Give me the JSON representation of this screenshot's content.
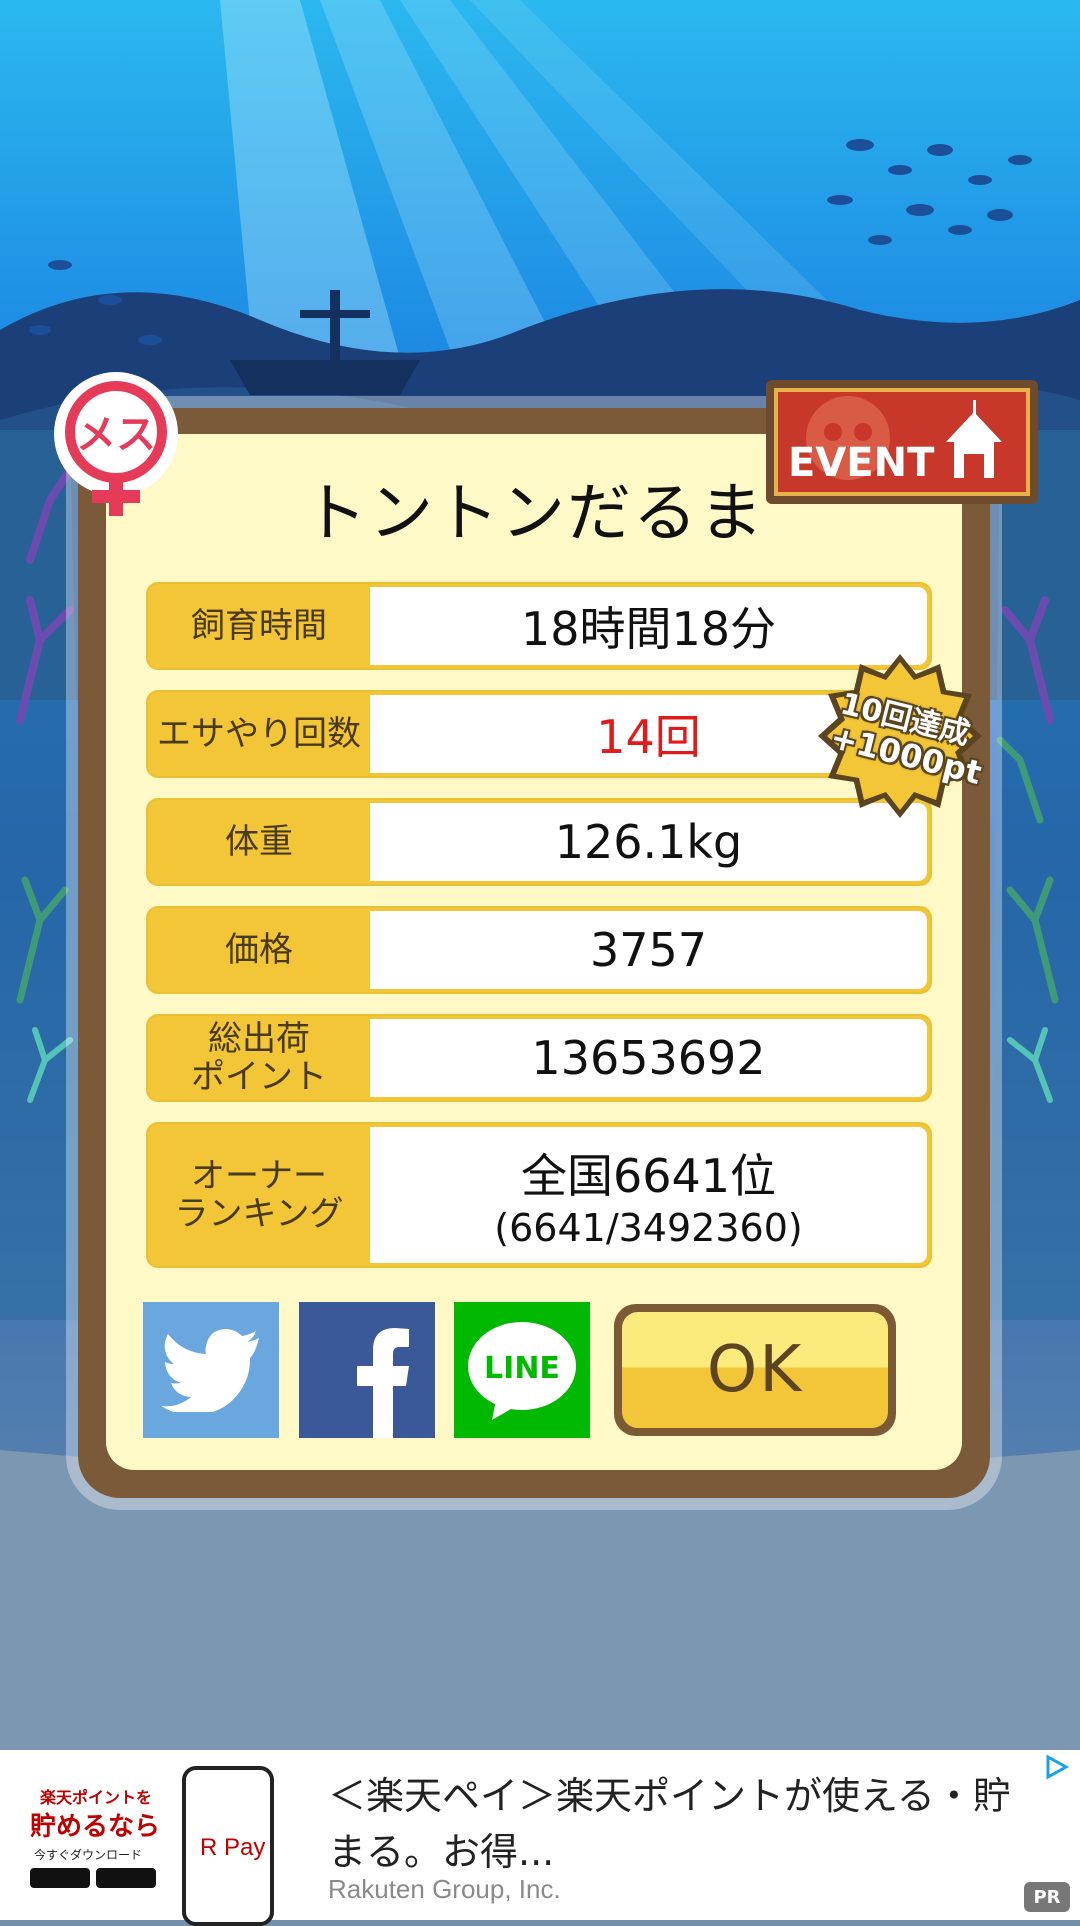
{
  "fish": {
    "gender_label": "メス",
    "name": "トントンだるま"
  },
  "event_badge": {
    "label": "EVENT"
  },
  "achievement_badge": {
    "line1": "10回達成",
    "line2": "+1000pt"
  },
  "stats": [
    {
      "label": "飼育時間",
      "value": "18時間18分"
    },
    {
      "label": "エサやり回数",
      "value": "14回",
      "highlight_color": "#e11a1a"
    },
    {
      "label": "体重",
      "value": "126.1kg"
    },
    {
      "label": "価格",
      "value": "3757"
    },
    {
      "label": "総出荷\nポイント",
      "value": "13653692"
    }
  ],
  "ranking": {
    "label": "オーナー\nランキング",
    "value": "全国6641位",
    "sub": "(6641/3492360)"
  },
  "share": {
    "twitter_color": "#69a7de",
    "facebook_color": "#3b5998",
    "line_label": "LINE",
    "line_color": "#00b900"
  },
  "ok_button": {
    "label": "OK"
  },
  "ad": {
    "thumb_line1": "楽天ポイントを",
    "thumb_line2": "貯めるなら",
    "thumb_line3": "今すぐダウンロード",
    "app_label": "R Pay",
    "title": "＜楽天ペイ＞楽天ポイントが使える・貯まる。お得...",
    "advertiser": "Rakuten Group, Inc.",
    "pr_label": "PR"
  }
}
